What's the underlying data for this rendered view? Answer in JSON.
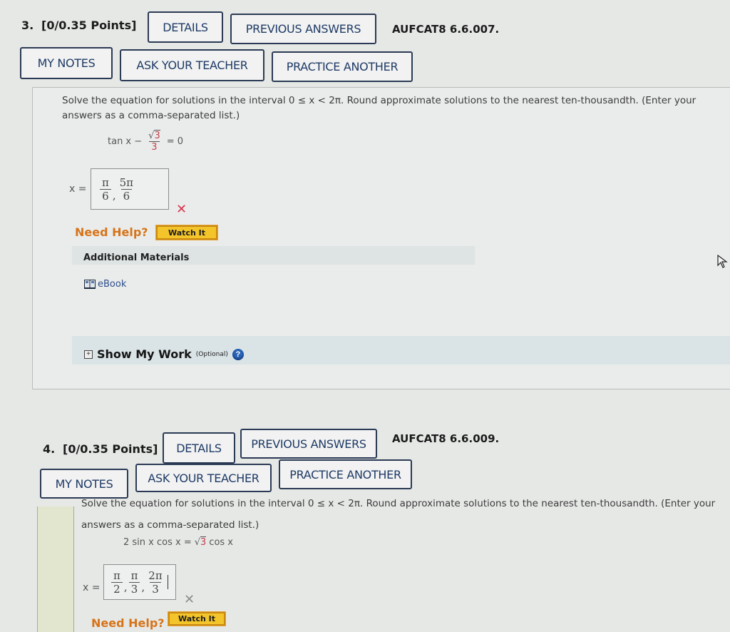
{
  "questions": [
    {
      "number": "3.",
      "points": "[0/0.35 Points]",
      "details_label": "DETAILS",
      "previous_answers_label": "PREVIOUS ANSWERS",
      "code": "AUFCAT8 6.6.007.",
      "my_notes_label": "MY NOTES",
      "ask_teacher_label": "ASK YOUR TEACHER",
      "practice_another_label": "PRACTICE ANOTHER",
      "prompt_line1": "Solve the equation for solutions in the interval  0 ≤ x < 2π.  Round approximate solutions to the nearest ten-thousandth. (Enter your",
      "prompt_line2": "answers as a comma-separated list.)",
      "equation": {
        "lhs": "tan x −",
        "sqrt_num": "3",
        "den": "3",
        "rhs": "= 0"
      },
      "answer_label": "x =",
      "answer_fractions": [
        {
          "num": "π",
          "den": "6"
        },
        {
          "num": "5π",
          "den": "6"
        }
      ],
      "answer_separator": ",",
      "result_icon": "incorrect-x-icon",
      "result_mark": "✕",
      "result_color": "#d9344f",
      "need_help_label": "Need Help?",
      "watch_it_label": "Watch It",
      "additional_materials_label": "Additional Materials",
      "ebook_label": "eBook",
      "show_my_work_label": "Show My Work",
      "optional_label": "(Optional)"
    },
    {
      "number": "4.",
      "points": "[0/0.35 Points]",
      "details_label": "DETAILS",
      "previous_answers_label": "PREVIOUS ANSWERS",
      "code": "AUFCAT8 6.6.009.",
      "my_notes_label": "MY NOTES",
      "ask_teacher_label": "ASK YOUR TEACHER",
      "practice_another_label": "PRACTICE ANOTHER",
      "prompt_line1": "Solve the equation for solutions in the interval  0 ≤ x < 2π.  Round approximate solutions to the nearest ten-thousandth. (Enter your",
      "prompt_line2": "answers as a comma-separated list.)",
      "equation": {
        "lhs": "2 sin x cos x =",
        "sqrt_num": "3",
        "rhs": "cos x"
      },
      "answer_label": "x =",
      "answer_fractions": [
        {
          "num": "π",
          "den": "2"
        },
        {
          "num": "π",
          "den": "3"
        },
        {
          "num": "2π",
          "den": "3"
        }
      ],
      "answer_separator": ",",
      "result_icon": "incorrect-x-icon",
      "result_mark": "✕",
      "result_color": "#8d8d8d",
      "need_help_label": "Need Help?",
      "watch_it_label": "Watch It"
    }
  ],
  "cursor": "mouse-pointer-icon"
}
